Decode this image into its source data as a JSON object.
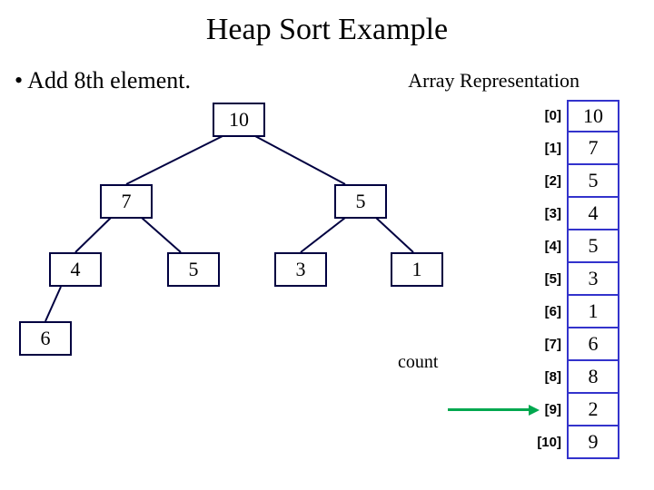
{
  "title": "Heap Sort Example",
  "bullet": "• Add 8th element.",
  "array_label": "Array Representation",
  "tree": {
    "nodes": {
      "n0": "10",
      "n1": "7",
      "n2": "5",
      "n3": "4",
      "n4": "5",
      "n5": "3",
      "n6": "1",
      "n7": "6"
    }
  },
  "array": {
    "rows": [
      {
        "idx": "[0]",
        "val": "10"
      },
      {
        "idx": "[1]",
        "val": "7"
      },
      {
        "idx": "[2]",
        "val": "5"
      },
      {
        "idx": "[3]",
        "val": "4"
      },
      {
        "idx": "[4]",
        "val": "5"
      },
      {
        "idx": "[5]",
        "val": "3"
      },
      {
        "idx": "[6]",
        "val": "1"
      },
      {
        "idx": "[7]",
        "val": "6"
      },
      {
        "idx": "[8]",
        "val": "8"
      },
      {
        "idx": "[9]",
        "val": "2"
      },
      {
        "idx": "[10]",
        "val": "9"
      }
    ]
  },
  "count_label": "count"
}
